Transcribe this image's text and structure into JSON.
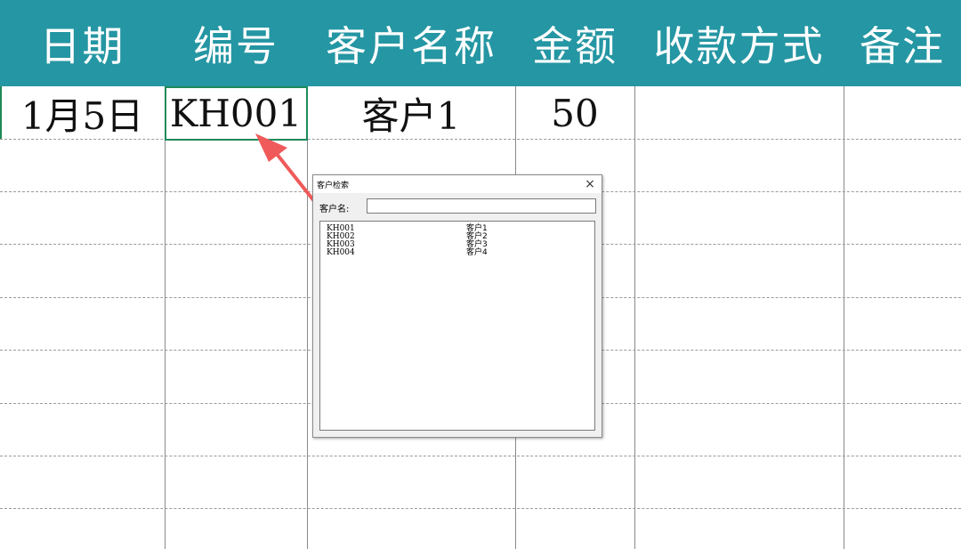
{
  "sheet": {
    "headers": [
      "日期",
      "编号",
      "客户名称",
      "金额",
      "收款方式",
      "备注"
    ],
    "row1": {
      "date": "1月5日",
      "code": "KH001",
      "customer": "客户1",
      "amount": "50",
      "payment": "",
      "note": ""
    }
  },
  "dialog": {
    "title": "客户检索",
    "close_icon": "×",
    "search_label": "客户名:",
    "search_value": "",
    "list": [
      {
        "code": "KH001",
        "name": "客户1"
      },
      {
        "code": "KH002",
        "name": "客户2"
      },
      {
        "code": "KH003",
        "name": "客户3"
      },
      {
        "code": "KH004",
        "name": "客户4"
      }
    ]
  },
  "colors": {
    "header_bg": "#2596a3",
    "active_border": "#1e8a5a",
    "arrow": "#f05a5a"
  }
}
